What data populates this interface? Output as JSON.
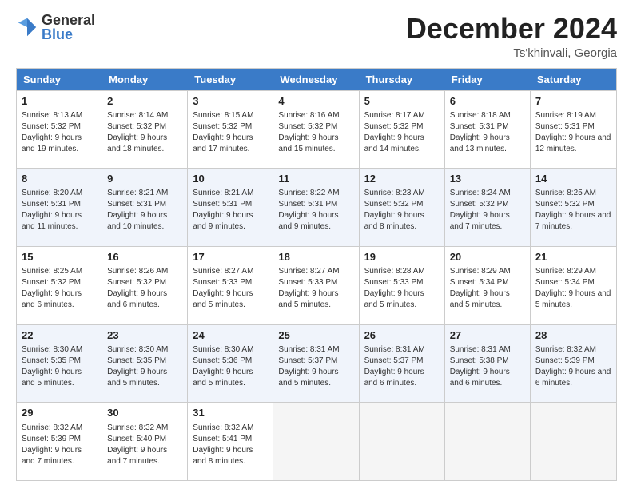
{
  "logo": {
    "general": "General",
    "blue": "Blue"
  },
  "header": {
    "month": "December 2024",
    "location": "Ts'khinvali, Georgia"
  },
  "days": [
    "Sunday",
    "Monday",
    "Tuesday",
    "Wednesday",
    "Thursday",
    "Friday",
    "Saturday"
  ],
  "weeks": [
    [
      {
        "num": "1",
        "rise": "8:13 AM",
        "set": "5:32 PM",
        "daylight": "9 hours and 19 minutes"
      },
      {
        "num": "2",
        "rise": "8:14 AM",
        "set": "5:32 PM",
        "daylight": "9 hours and 18 minutes"
      },
      {
        "num": "3",
        "rise": "8:15 AM",
        "set": "5:32 PM",
        "daylight": "9 hours and 17 minutes"
      },
      {
        "num": "4",
        "rise": "8:16 AM",
        "set": "5:32 PM",
        "daylight": "9 hours and 15 minutes"
      },
      {
        "num": "5",
        "rise": "8:17 AM",
        "set": "5:32 PM",
        "daylight": "9 hours and 14 minutes"
      },
      {
        "num": "6",
        "rise": "8:18 AM",
        "set": "5:31 PM",
        "daylight": "9 hours and 13 minutes"
      },
      {
        "num": "7",
        "rise": "8:19 AM",
        "set": "5:31 PM",
        "daylight": "9 hours and 12 minutes"
      }
    ],
    [
      {
        "num": "8",
        "rise": "8:20 AM",
        "set": "5:31 PM",
        "daylight": "9 hours and 11 minutes"
      },
      {
        "num": "9",
        "rise": "8:21 AM",
        "set": "5:31 PM",
        "daylight": "9 hours and 10 minutes"
      },
      {
        "num": "10",
        "rise": "8:21 AM",
        "set": "5:31 PM",
        "daylight": "9 hours and 9 minutes"
      },
      {
        "num": "11",
        "rise": "8:22 AM",
        "set": "5:31 PM",
        "daylight": "9 hours and 9 minutes"
      },
      {
        "num": "12",
        "rise": "8:23 AM",
        "set": "5:32 PM",
        "daylight": "9 hours and 8 minutes"
      },
      {
        "num": "13",
        "rise": "8:24 AM",
        "set": "5:32 PM",
        "daylight": "9 hours and 7 minutes"
      },
      {
        "num": "14",
        "rise": "8:25 AM",
        "set": "5:32 PM",
        "daylight": "9 hours and 7 minutes"
      }
    ],
    [
      {
        "num": "15",
        "rise": "8:25 AM",
        "set": "5:32 PM",
        "daylight": "9 hours and 6 minutes"
      },
      {
        "num": "16",
        "rise": "8:26 AM",
        "set": "5:32 PM",
        "daylight": "9 hours and 6 minutes"
      },
      {
        "num": "17",
        "rise": "8:27 AM",
        "set": "5:33 PM",
        "daylight": "9 hours and 5 minutes"
      },
      {
        "num": "18",
        "rise": "8:27 AM",
        "set": "5:33 PM",
        "daylight": "9 hours and 5 minutes"
      },
      {
        "num": "19",
        "rise": "8:28 AM",
        "set": "5:33 PM",
        "daylight": "9 hours and 5 minutes"
      },
      {
        "num": "20",
        "rise": "8:29 AM",
        "set": "5:34 PM",
        "daylight": "9 hours and 5 minutes"
      },
      {
        "num": "21",
        "rise": "8:29 AM",
        "set": "5:34 PM",
        "daylight": "9 hours and 5 minutes"
      }
    ],
    [
      {
        "num": "22",
        "rise": "8:30 AM",
        "set": "5:35 PM",
        "daylight": "9 hours and 5 minutes"
      },
      {
        "num": "23",
        "rise": "8:30 AM",
        "set": "5:35 PM",
        "daylight": "9 hours and 5 minutes"
      },
      {
        "num": "24",
        "rise": "8:30 AM",
        "set": "5:36 PM",
        "daylight": "9 hours and 5 minutes"
      },
      {
        "num": "25",
        "rise": "8:31 AM",
        "set": "5:37 PM",
        "daylight": "9 hours and 5 minutes"
      },
      {
        "num": "26",
        "rise": "8:31 AM",
        "set": "5:37 PM",
        "daylight": "9 hours and 6 minutes"
      },
      {
        "num": "27",
        "rise": "8:31 AM",
        "set": "5:38 PM",
        "daylight": "9 hours and 6 minutes"
      },
      {
        "num": "28",
        "rise": "8:32 AM",
        "set": "5:39 PM",
        "daylight": "9 hours and 6 minutes"
      }
    ],
    [
      {
        "num": "29",
        "rise": "8:32 AM",
        "set": "5:39 PM",
        "daylight": "9 hours and 7 minutes"
      },
      {
        "num": "30",
        "rise": "8:32 AM",
        "set": "5:40 PM",
        "daylight": "9 hours and 7 minutes"
      },
      {
        "num": "31",
        "rise": "8:32 AM",
        "set": "5:41 PM",
        "daylight": "9 hours and 8 minutes"
      },
      null,
      null,
      null,
      null
    ]
  ]
}
